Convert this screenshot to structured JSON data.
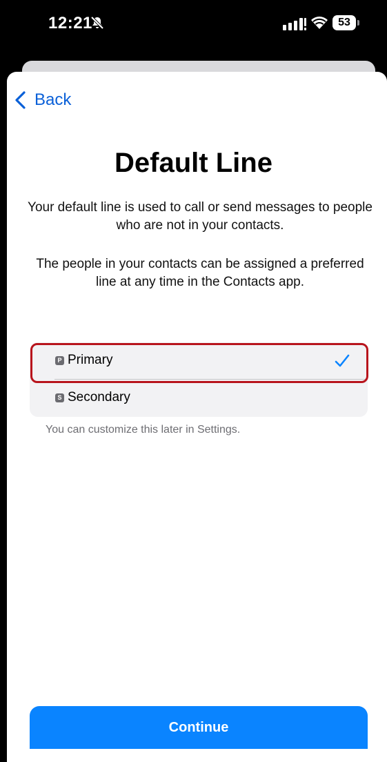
{
  "status_bar": {
    "time": "12:21",
    "battery": "53",
    "icons": [
      "bell-slash-icon",
      "cellular-signal-icon",
      "wifi-icon",
      "battery-icon"
    ]
  },
  "nav": {
    "back_label": "Back",
    "back_icon": "chevron-left-icon"
  },
  "title": "Default Line",
  "description": [
    "Your default line is used to call or send messages to people who are not in your contacts.",
    "The people in your contacts can be assigned a preferred line at any time in the Contacts app."
  ],
  "options": [
    {
      "badge": "P",
      "label": "Primary",
      "selected": true
    },
    {
      "badge": "S",
      "label": "Secondary",
      "selected": false
    }
  ],
  "footer_note": "You can customize this later in Settings.",
  "continue_label": "Continue",
  "colors": {
    "accent": "#0a84ff",
    "link": "#0a60d8",
    "highlight": "#b8141c",
    "group_background": "#f2f2f4"
  }
}
